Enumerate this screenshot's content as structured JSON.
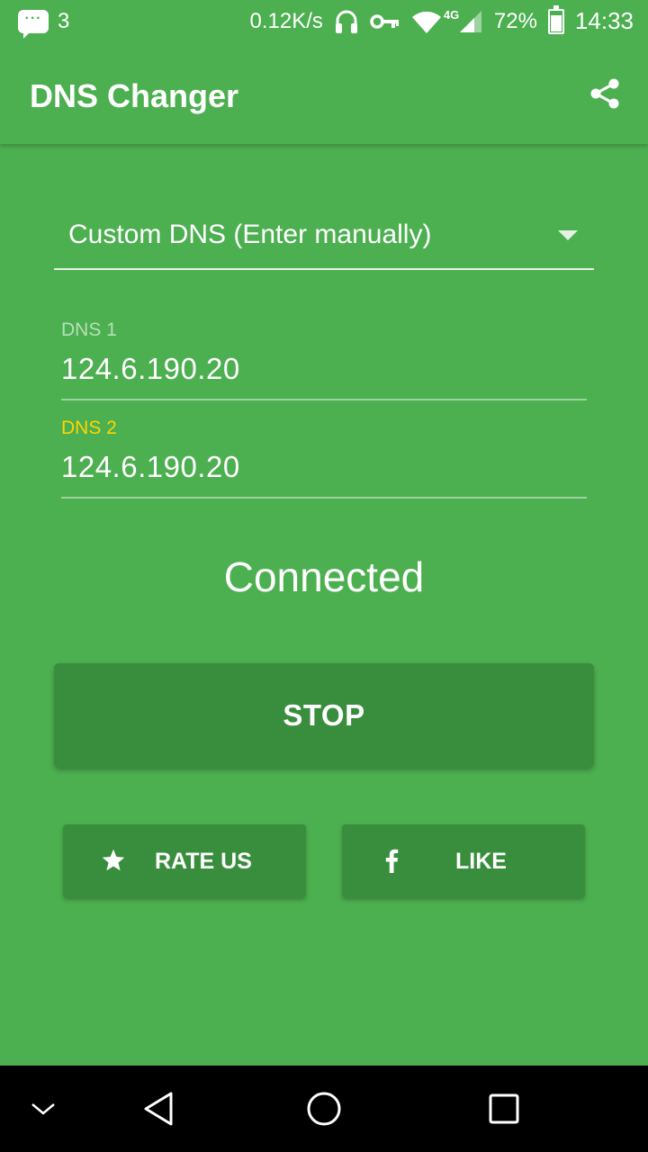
{
  "status_bar": {
    "notification_count": "3",
    "net_speed": "0.12K/s",
    "network_type": "4G",
    "battery": "72%",
    "battery_level": 0.72,
    "time": "14:33",
    "icons": [
      "message-icon",
      "headset-icon",
      "vpn-key-icon",
      "wifi-icon",
      "signal-icon",
      "battery-icon"
    ]
  },
  "app_bar": {
    "title": "DNS Changer",
    "share_icon": "share-icon"
  },
  "dns_selector": {
    "selected": "Custom DNS (Enter manually)"
  },
  "dns1": {
    "label": "DNS 1",
    "value": "124.6.190.20"
  },
  "dns2": {
    "label": "DNS 2",
    "value": "124.6.190.20"
  },
  "connection_status": "Connected",
  "buttons": {
    "stop": "STOP",
    "rate": "RATE US",
    "like": "LIKE"
  },
  "colors": {
    "background": "#4caf50",
    "button": "#388e3c",
    "focused_label": "#ffd600",
    "navbar": "#000000"
  },
  "nav_bar": {
    "icons": [
      "collapse-icon",
      "back-icon",
      "home-icon",
      "recents-icon"
    ]
  }
}
